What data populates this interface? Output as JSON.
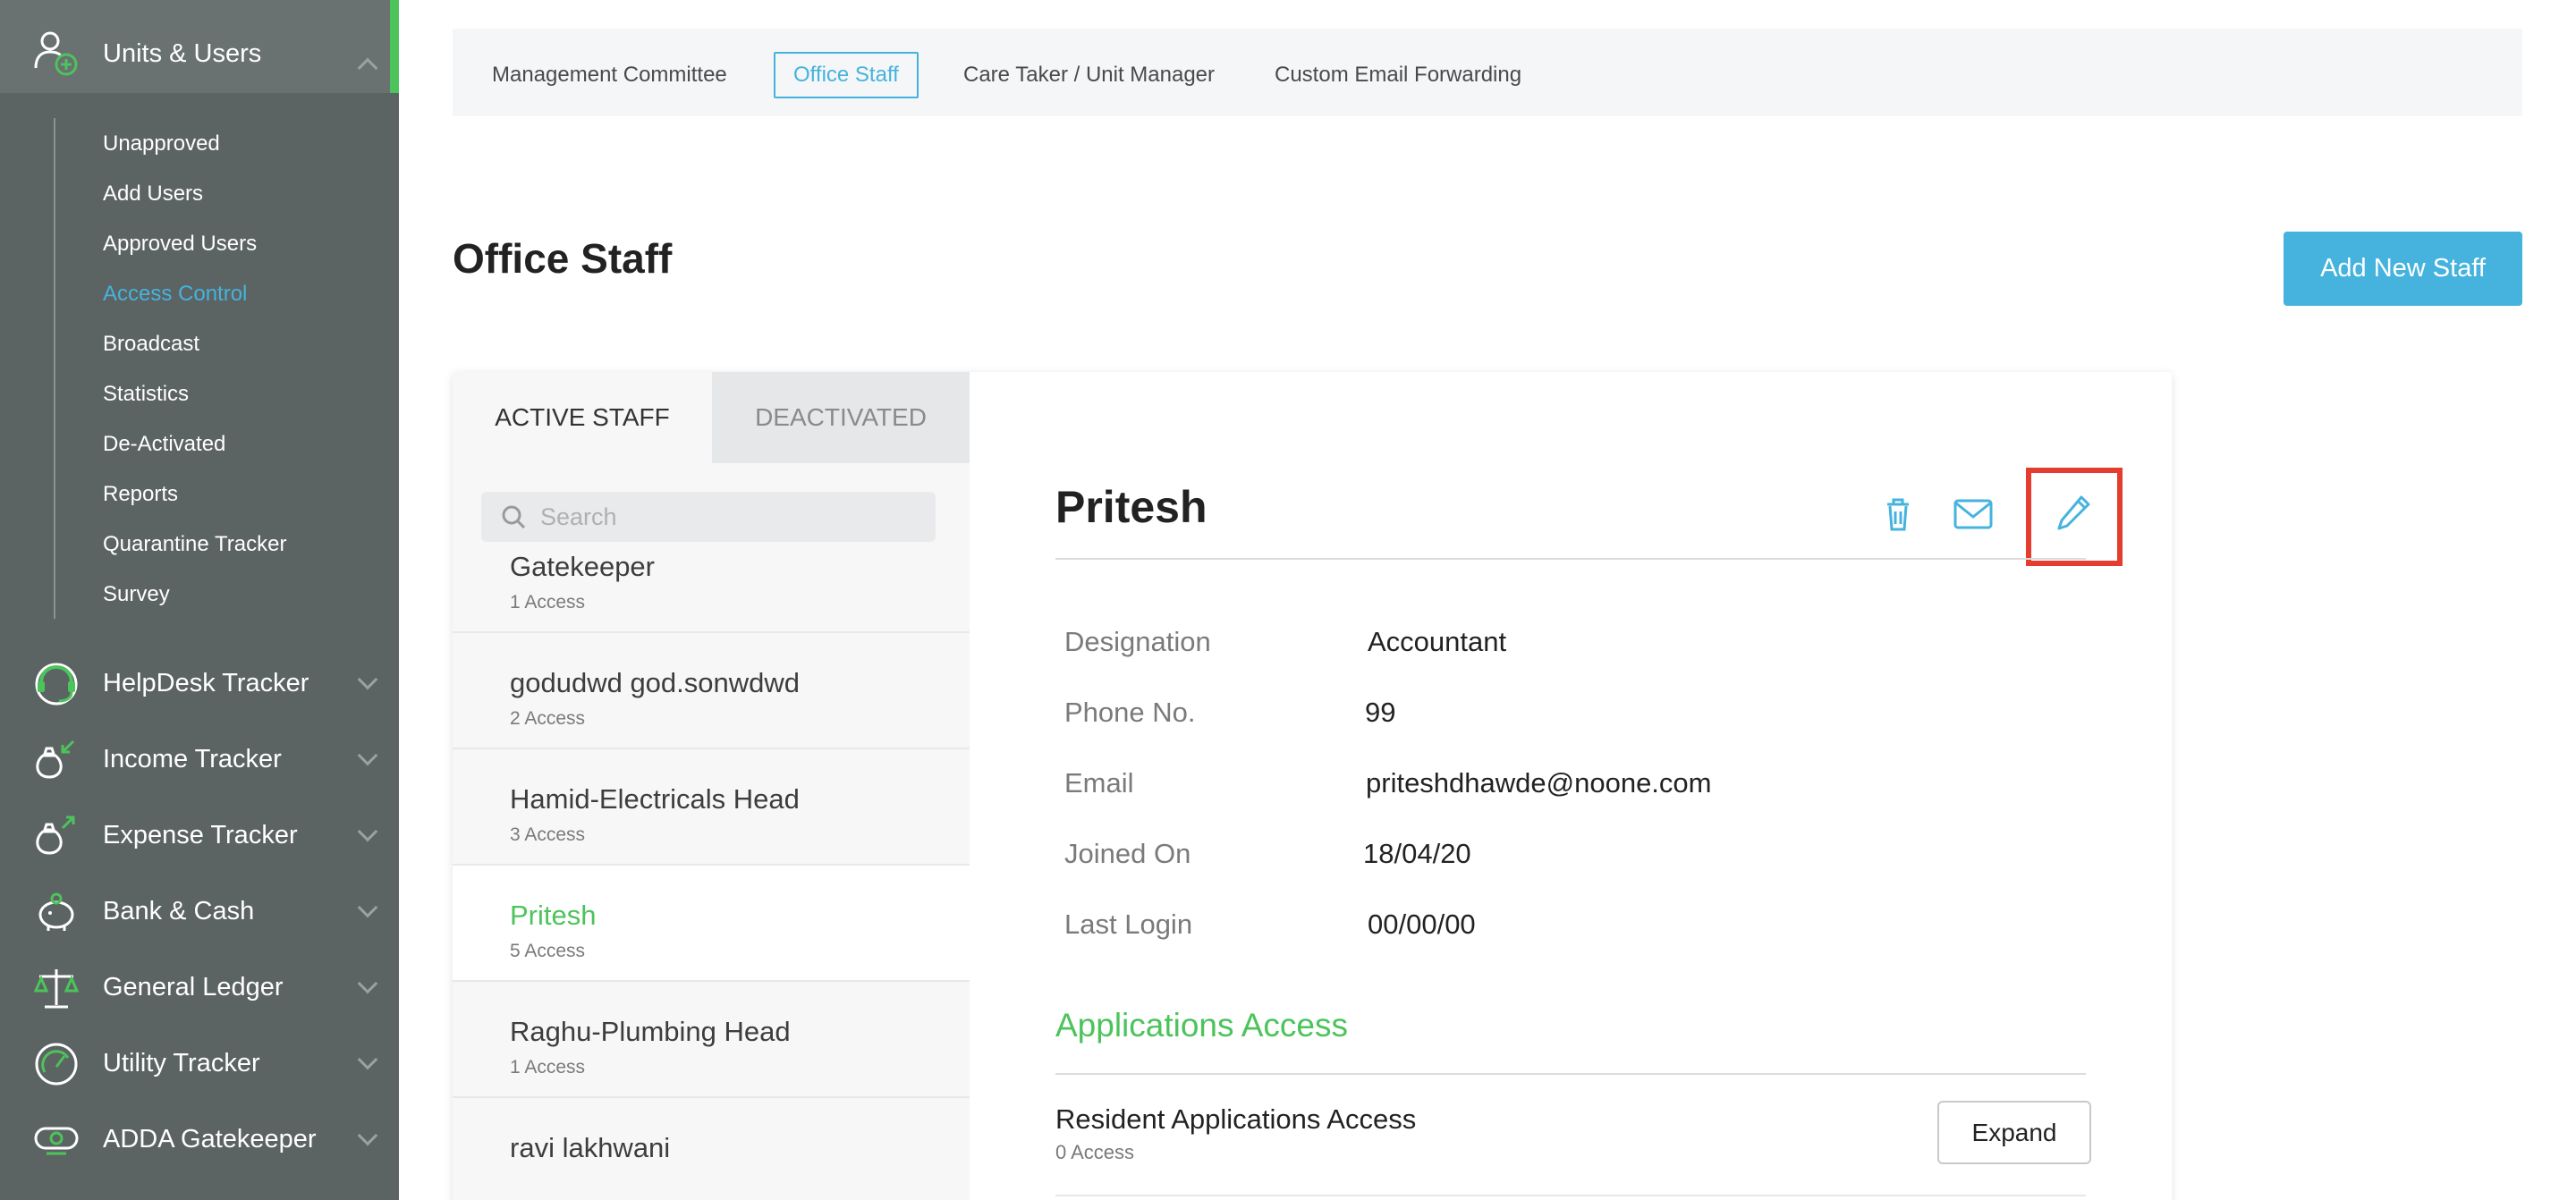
{
  "sidebar": {
    "active_section": "Units & Users",
    "sub_items": [
      {
        "label": "Unapproved",
        "active": false
      },
      {
        "label": "Add Users",
        "active": false
      },
      {
        "label": "Approved Users",
        "active": false
      },
      {
        "label": "Access Control",
        "active": true
      },
      {
        "label": "Broadcast",
        "active": false
      },
      {
        "label": "Statistics",
        "active": false
      },
      {
        "label": "De-Activated",
        "active": false
      },
      {
        "label": "Reports",
        "active": false
      },
      {
        "label": "Quarantine Tracker",
        "active": false
      },
      {
        "label": "Survey",
        "active": false
      }
    ],
    "main_items": [
      {
        "label": "HelpDesk Tracker",
        "icon": "headset-icon"
      },
      {
        "label": "Income Tracker",
        "icon": "income-bag-icon"
      },
      {
        "label": "Expense Tracker",
        "icon": "expense-bag-icon"
      },
      {
        "label": "Bank & Cash",
        "icon": "piggy-bank-icon"
      },
      {
        "label": "General Ledger",
        "icon": "scales-icon"
      },
      {
        "label": "Utility Tracker",
        "icon": "gauge-icon"
      },
      {
        "label": "ADDA Gatekeeper",
        "icon": "gatekeeper-icon"
      }
    ]
  },
  "top_tabs": [
    {
      "label": "Management Committee",
      "active": false
    },
    {
      "label": "Office Staff",
      "active": true
    },
    {
      "label": "Care Taker / Unit Manager",
      "active": false
    },
    {
      "label": "Custom Email Forwarding",
      "active": false
    }
  ],
  "page": {
    "title": "Office Staff",
    "add_button": "Add New Staff"
  },
  "staff_panel": {
    "tabs": {
      "active": "ACTIVE STAFF",
      "inactive": "DEACTIVATED"
    },
    "search_placeholder": "Search",
    "list": [
      {
        "name": "Gatekeeper",
        "access": "1 Access"
      },
      {
        "name": "godudwd god.sonwdwd",
        "access": "2 Access"
      },
      {
        "name": "Hamid-Electricals Head",
        "access": "3 Access"
      },
      {
        "name": "Pritesh",
        "access": "5 Access"
      },
      {
        "name": "Raghu-Plumbing Head",
        "access": "1 Access"
      },
      {
        "name": "ravi lakhwani",
        "access": ""
      }
    ]
  },
  "detail": {
    "name": "Pritesh",
    "fields": {
      "designation_label": "Designation",
      "designation": "Accountant",
      "phone_label": "Phone No.",
      "phone": "99",
      "email_label": "Email",
      "email": "priteshdhawde@noone.com",
      "joined_label": "Joined On",
      "joined": "18/04/20",
      "login_label": "Last Login",
      "login": "00/00/00"
    },
    "apps_title": "Applications Access",
    "resident_title": "Resident Applications Access",
    "resident_access": "0 Access",
    "expand_label": "Expand"
  },
  "colors": {
    "accent": "#45b3dd",
    "green": "#4cc35b",
    "sidebar": "#5c6363",
    "highlight": "#e43d2f"
  }
}
